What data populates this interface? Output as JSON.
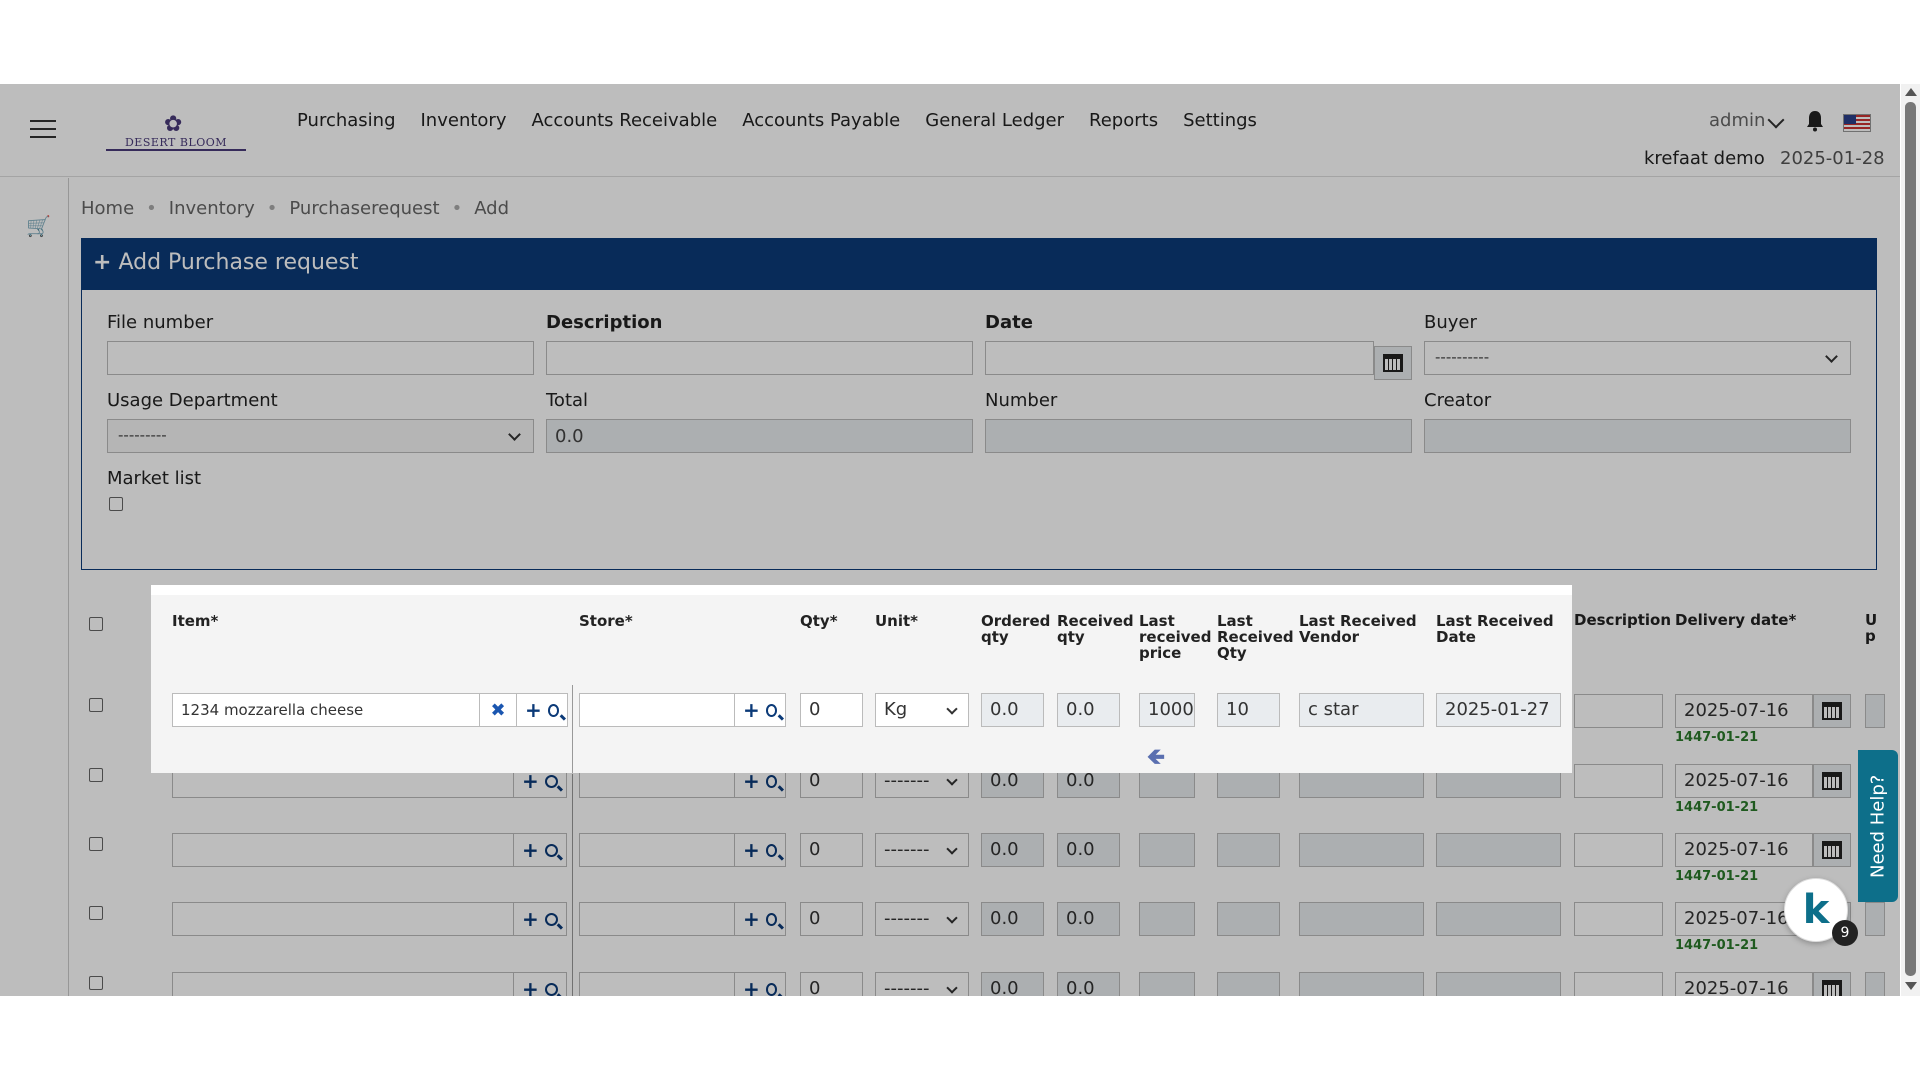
{
  "nav": {
    "logo_text": "DESERT BLOOM",
    "menu": [
      "Purchasing",
      "Inventory",
      "Accounts Receivable",
      "Accounts Payable",
      "General Ledger",
      "Reports",
      "Settings"
    ],
    "user": "admin",
    "company": "krefaat demo",
    "date": "2025-01-28"
  },
  "breadcrumb": [
    "Home",
    "Inventory",
    "Purchaserequest",
    "Add"
  ],
  "panel": {
    "title": "Add Purchase request",
    "file_number_label": "File number",
    "description_label": "Description",
    "date_label": "Date",
    "buyer_label": "Buyer",
    "buyer_value": "----------",
    "usage_department_label": "Usage Department",
    "usage_department_value": "---------",
    "total_label": "Total",
    "total_value": "0.0",
    "number_label": "Number",
    "creator_label": "Creator",
    "market_list_label": "Market list"
  },
  "table": {
    "headers": {
      "item": "Item*",
      "store": "Store*",
      "qty": "Qty*",
      "unit": "Unit*",
      "ordered_qty_1": "Ordered",
      "ordered_qty_2": "qty",
      "received_qty_1": "Received",
      "received_qty_2": "qty",
      "last_price_1": "Last",
      "last_price_2": "received",
      "last_price_3": "price",
      "last_qty_1": "Last",
      "last_qty_2": "Received",
      "last_qty_3": "Qty",
      "last_vendor_1": "Last Received",
      "last_vendor_2": "Vendor",
      "last_date_1": "Last Received",
      "last_date_2": "Date",
      "description": "Description",
      "delivery": "Delivery date*",
      "unit_price_1": "U",
      "unit_price_2": "p"
    },
    "first_row": {
      "item": "1234 mozzarella cheese",
      "qty": "0",
      "unit": "Kg",
      "ordered": "0.0",
      "received": "0.0",
      "last_price": "1000",
      "last_qty": "10",
      "last_vendor": "c star",
      "last_date": "2025-01-27",
      "delivery": "2025-07-16",
      "hijri": "1447-01-21"
    },
    "other_rows": [
      {
        "qty": "0",
        "unit": "-------",
        "ordered": "0.0",
        "received": "0.0",
        "delivery": "2025-07-16",
        "hijri": "1447-01-21"
      },
      {
        "qty": "0",
        "unit": "-------",
        "ordered": "0.0",
        "received": "0.0",
        "delivery": "2025-07-16",
        "hijri": "1447-01-21"
      },
      {
        "qty": "0",
        "unit": "-------",
        "ordered": "0.0",
        "received": "0.0",
        "delivery": "2025-07-16",
        "hijri": "1447-01-21"
      },
      {
        "qty": "0",
        "unit": "-------",
        "ordered": "0.0",
        "received": "0.0",
        "delivery": "2025-07-16",
        "hijri": ""
      }
    ]
  },
  "help": {
    "label": "Need Help?",
    "badge_letter": "k",
    "badge_count": "9"
  },
  "colors": {
    "panel_header": "#0b3a78",
    "help_tab": "#0d6f8a",
    "hijri_text": "#2a7a2a"
  }
}
